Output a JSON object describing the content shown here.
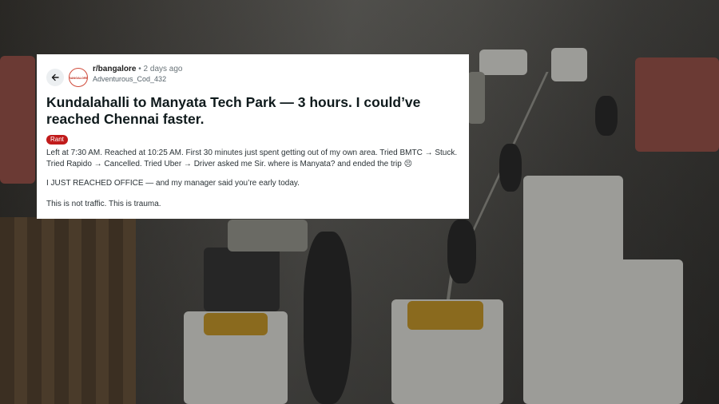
{
  "post": {
    "subreddit": "r/bangalore",
    "separator": "•",
    "age": "2 days ago",
    "author": "Adventurous_Cod_432",
    "avatar_text": "BANGALORE",
    "title": "Kundalahalli to Manyata Tech Park — 3 hours. I could’ve reached Chennai faster.",
    "flair": "Rant",
    "flair_color": "#c11b1b",
    "body_paragraphs": [
      "Left at 7:30 AM. Reached at 10:25 AM. First 30 minutes just spent getting out of my own area. Tried BMTC → Stuck. Tried Rapido → Cancelled. Tried Uber → Driver asked me Sir. where is Manyata? and ended the trip 😣",
      "I JUST REACHED OFFICE — and my manager said you’re early today.",
      "This is not traffic. This is trauma."
    ]
  },
  "icons": {
    "back": "back-arrow-icon"
  }
}
